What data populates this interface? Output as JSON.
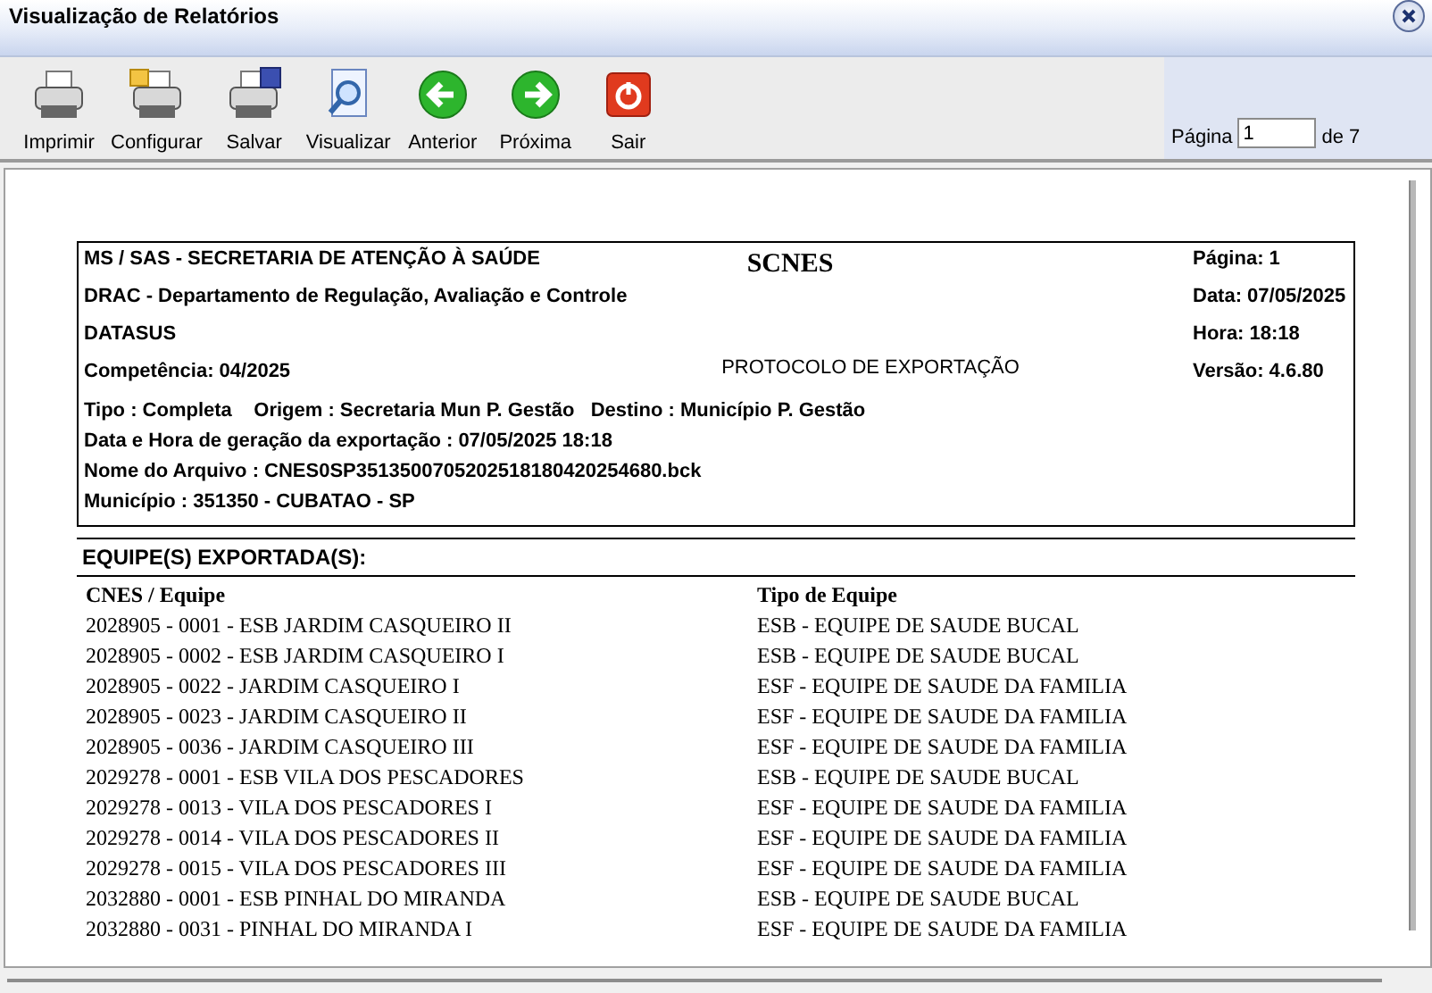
{
  "window": {
    "title": "Visualização de Relatórios"
  },
  "toolbar": [
    {
      "label": "Imprimir",
      "kind": "print"
    },
    {
      "label": "Configurar",
      "kind": "setup"
    },
    {
      "label": "Salvar",
      "kind": "save"
    },
    {
      "label": "Visualizar",
      "kind": "preview"
    },
    {
      "label": "Anterior",
      "kind": "prev"
    },
    {
      "label": "Próxima",
      "kind": "next"
    },
    {
      "label": "Sair",
      "kind": "exit"
    }
  ],
  "pager": {
    "label": "Página",
    "value": "1",
    "total": "de 7"
  },
  "report": {
    "header_left": [
      "MS / SAS - SECRETARIA DE ATENÇÃO À SAÚDE",
      "DRAC - Departamento de Regulação, Avaliação e Controle",
      "DATASUS",
      "Competência: 04/2025"
    ],
    "title": "SCNES",
    "subtitle": "PROTOCOLO DE EXPORTAÇÃO",
    "header_right": [
      "Página: 1",
      "Data: 07/05/2025",
      "Hora: 18:18",
      "Versão: 4.6.80"
    ],
    "details": [
      "Tipo : Completa    Origem : Secretaria Mun P. Gestão   Destino : Município P. Gestão",
      "Data e Hora de geração da exportação : 07/05/2025 18:18",
      "Nome do Arquivo : CNES0SP3513500705202518180420254680.bck",
      "Município : 351350 - CUBATAO - SP"
    ],
    "section": "EQUIPE(S) EXPORTADA(S):",
    "columns": [
      "CNES / Equipe",
      "Tipo de Equipe"
    ],
    "rows": [
      [
        "2028905 - 0001 - ESB JARDIM CASQUEIRO II",
        "ESB - EQUIPE DE SAUDE BUCAL"
      ],
      [
        "2028905 - 0002 - ESB JARDIM CASQUEIRO I",
        "ESB - EQUIPE DE SAUDE BUCAL"
      ],
      [
        "2028905 - 0022 - JARDIM CASQUEIRO I",
        "ESF - EQUIPE DE SAUDE DA FAMILIA"
      ],
      [
        "2028905 - 0023 - JARDIM CASQUEIRO II",
        "ESF - EQUIPE DE SAUDE DA FAMILIA"
      ],
      [
        "2028905 - 0036 - JARDIM CASQUEIRO III",
        "ESF - EQUIPE DE SAUDE DA FAMILIA"
      ],
      [
        "2029278 - 0001 - ESB VILA DOS PESCADORES",
        "ESB - EQUIPE DE SAUDE BUCAL"
      ],
      [
        "2029278 - 0013 - VILA DOS PESCADORES I",
        "ESF - EQUIPE DE SAUDE DA FAMILIA"
      ],
      [
        "2029278 - 0014 - VILA DOS PESCADORES II",
        "ESF - EQUIPE DE SAUDE DA FAMILIA"
      ],
      [
        "2029278 - 0015 - VILA DOS PESCADORES III",
        "ESF - EQUIPE DE SAUDE DA FAMILIA"
      ],
      [
        "2032880 - 0001 - ESB PINHAL DO MIRANDA",
        "ESB - EQUIPE DE SAUDE BUCAL"
      ],
      [
        "2032880 - 0031 - PINHAL DO MIRANDA I",
        "ESF - EQUIPE DE SAUDE DA FAMILIA"
      ]
    ]
  }
}
